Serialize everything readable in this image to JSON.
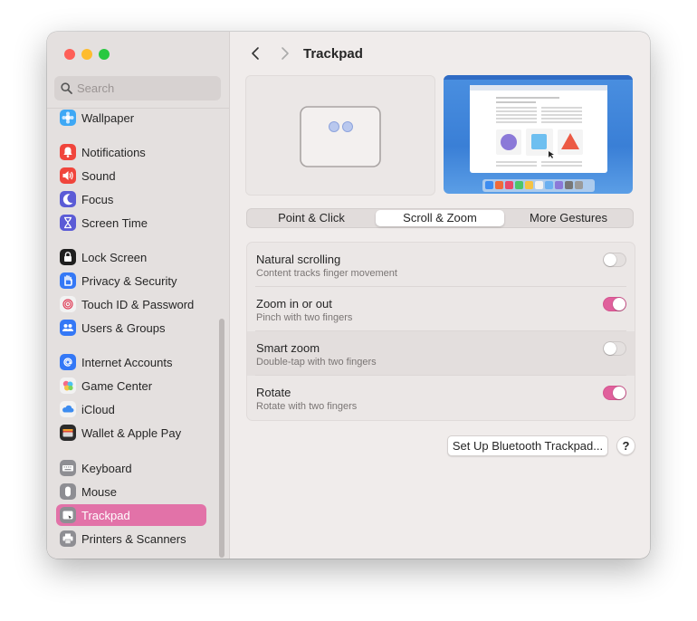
{
  "window": {
    "title": "Trackpad"
  },
  "search": {
    "placeholder": "Search"
  },
  "sidebar": {
    "items": [
      {
        "label": "Wallpaper",
        "icon": "wallpaper-icon",
        "color": "#3ea8f5"
      },
      {
        "label": "Notifications",
        "icon": "notifications-icon",
        "color": "#f0453c"
      },
      {
        "label": "Sound",
        "icon": "sound-icon",
        "color": "#f0453c"
      },
      {
        "label": "Focus",
        "icon": "focus-icon",
        "color": "#5b5bd6"
      },
      {
        "label": "Screen Time",
        "icon": "screen-time-icon",
        "color": "#5b5bd6"
      },
      {
        "label": "Lock Screen",
        "icon": "lock-screen-icon",
        "color": "#1f1f1f"
      },
      {
        "label": "Privacy & Security",
        "icon": "privacy-icon",
        "color": "#3478f6"
      },
      {
        "label": "Touch ID & Password",
        "icon": "touch-id-icon",
        "color": "#f2f2f2"
      },
      {
        "label": "Users & Groups",
        "icon": "users-icon",
        "color": "#3478f6"
      },
      {
        "label": "Internet Accounts",
        "icon": "internet-accounts-icon",
        "color": "#3478f6"
      },
      {
        "label": "Game Center",
        "icon": "game-center-icon",
        "color": "#f2f2f2"
      },
      {
        "label": "iCloud",
        "icon": "icloud-icon",
        "color": "#f2f2f2"
      },
      {
        "label": "Wallet & Apple Pay",
        "icon": "wallet-icon",
        "color": "#2b2b2b"
      },
      {
        "label": "Keyboard",
        "icon": "keyboard-icon",
        "color": "#8e8e93"
      },
      {
        "label": "Mouse",
        "icon": "mouse-icon",
        "color": "#8e8e93"
      },
      {
        "label": "Trackpad",
        "icon": "trackpad-icon",
        "color": "#8e8e93",
        "selected": true
      },
      {
        "label": "Printers & Scanners",
        "icon": "printers-icon",
        "color": "#8e8e93"
      }
    ]
  },
  "tabs": [
    {
      "label": "Point & Click",
      "active": false
    },
    {
      "label": "Scroll & Zoom",
      "active": true
    },
    {
      "label": "More Gestures",
      "active": false
    }
  ],
  "settings": [
    {
      "title": "Natural scrolling",
      "subtitle": "Content tracks finger movement",
      "on": false
    },
    {
      "title": "Zoom in or out",
      "subtitle": "Pinch with two fingers",
      "on": true
    },
    {
      "title": "Smart zoom",
      "subtitle": "Double-tap with two fingers",
      "on": false
    },
    {
      "title": "Rotate",
      "subtitle": "Rotate with two fingers",
      "on": true
    }
  ],
  "buttons": {
    "bluetooth": "Set Up Bluetooth Trackpad...",
    "help": "?"
  },
  "colors": {
    "accent": "#e0609c",
    "selection": "#e272a8"
  }
}
